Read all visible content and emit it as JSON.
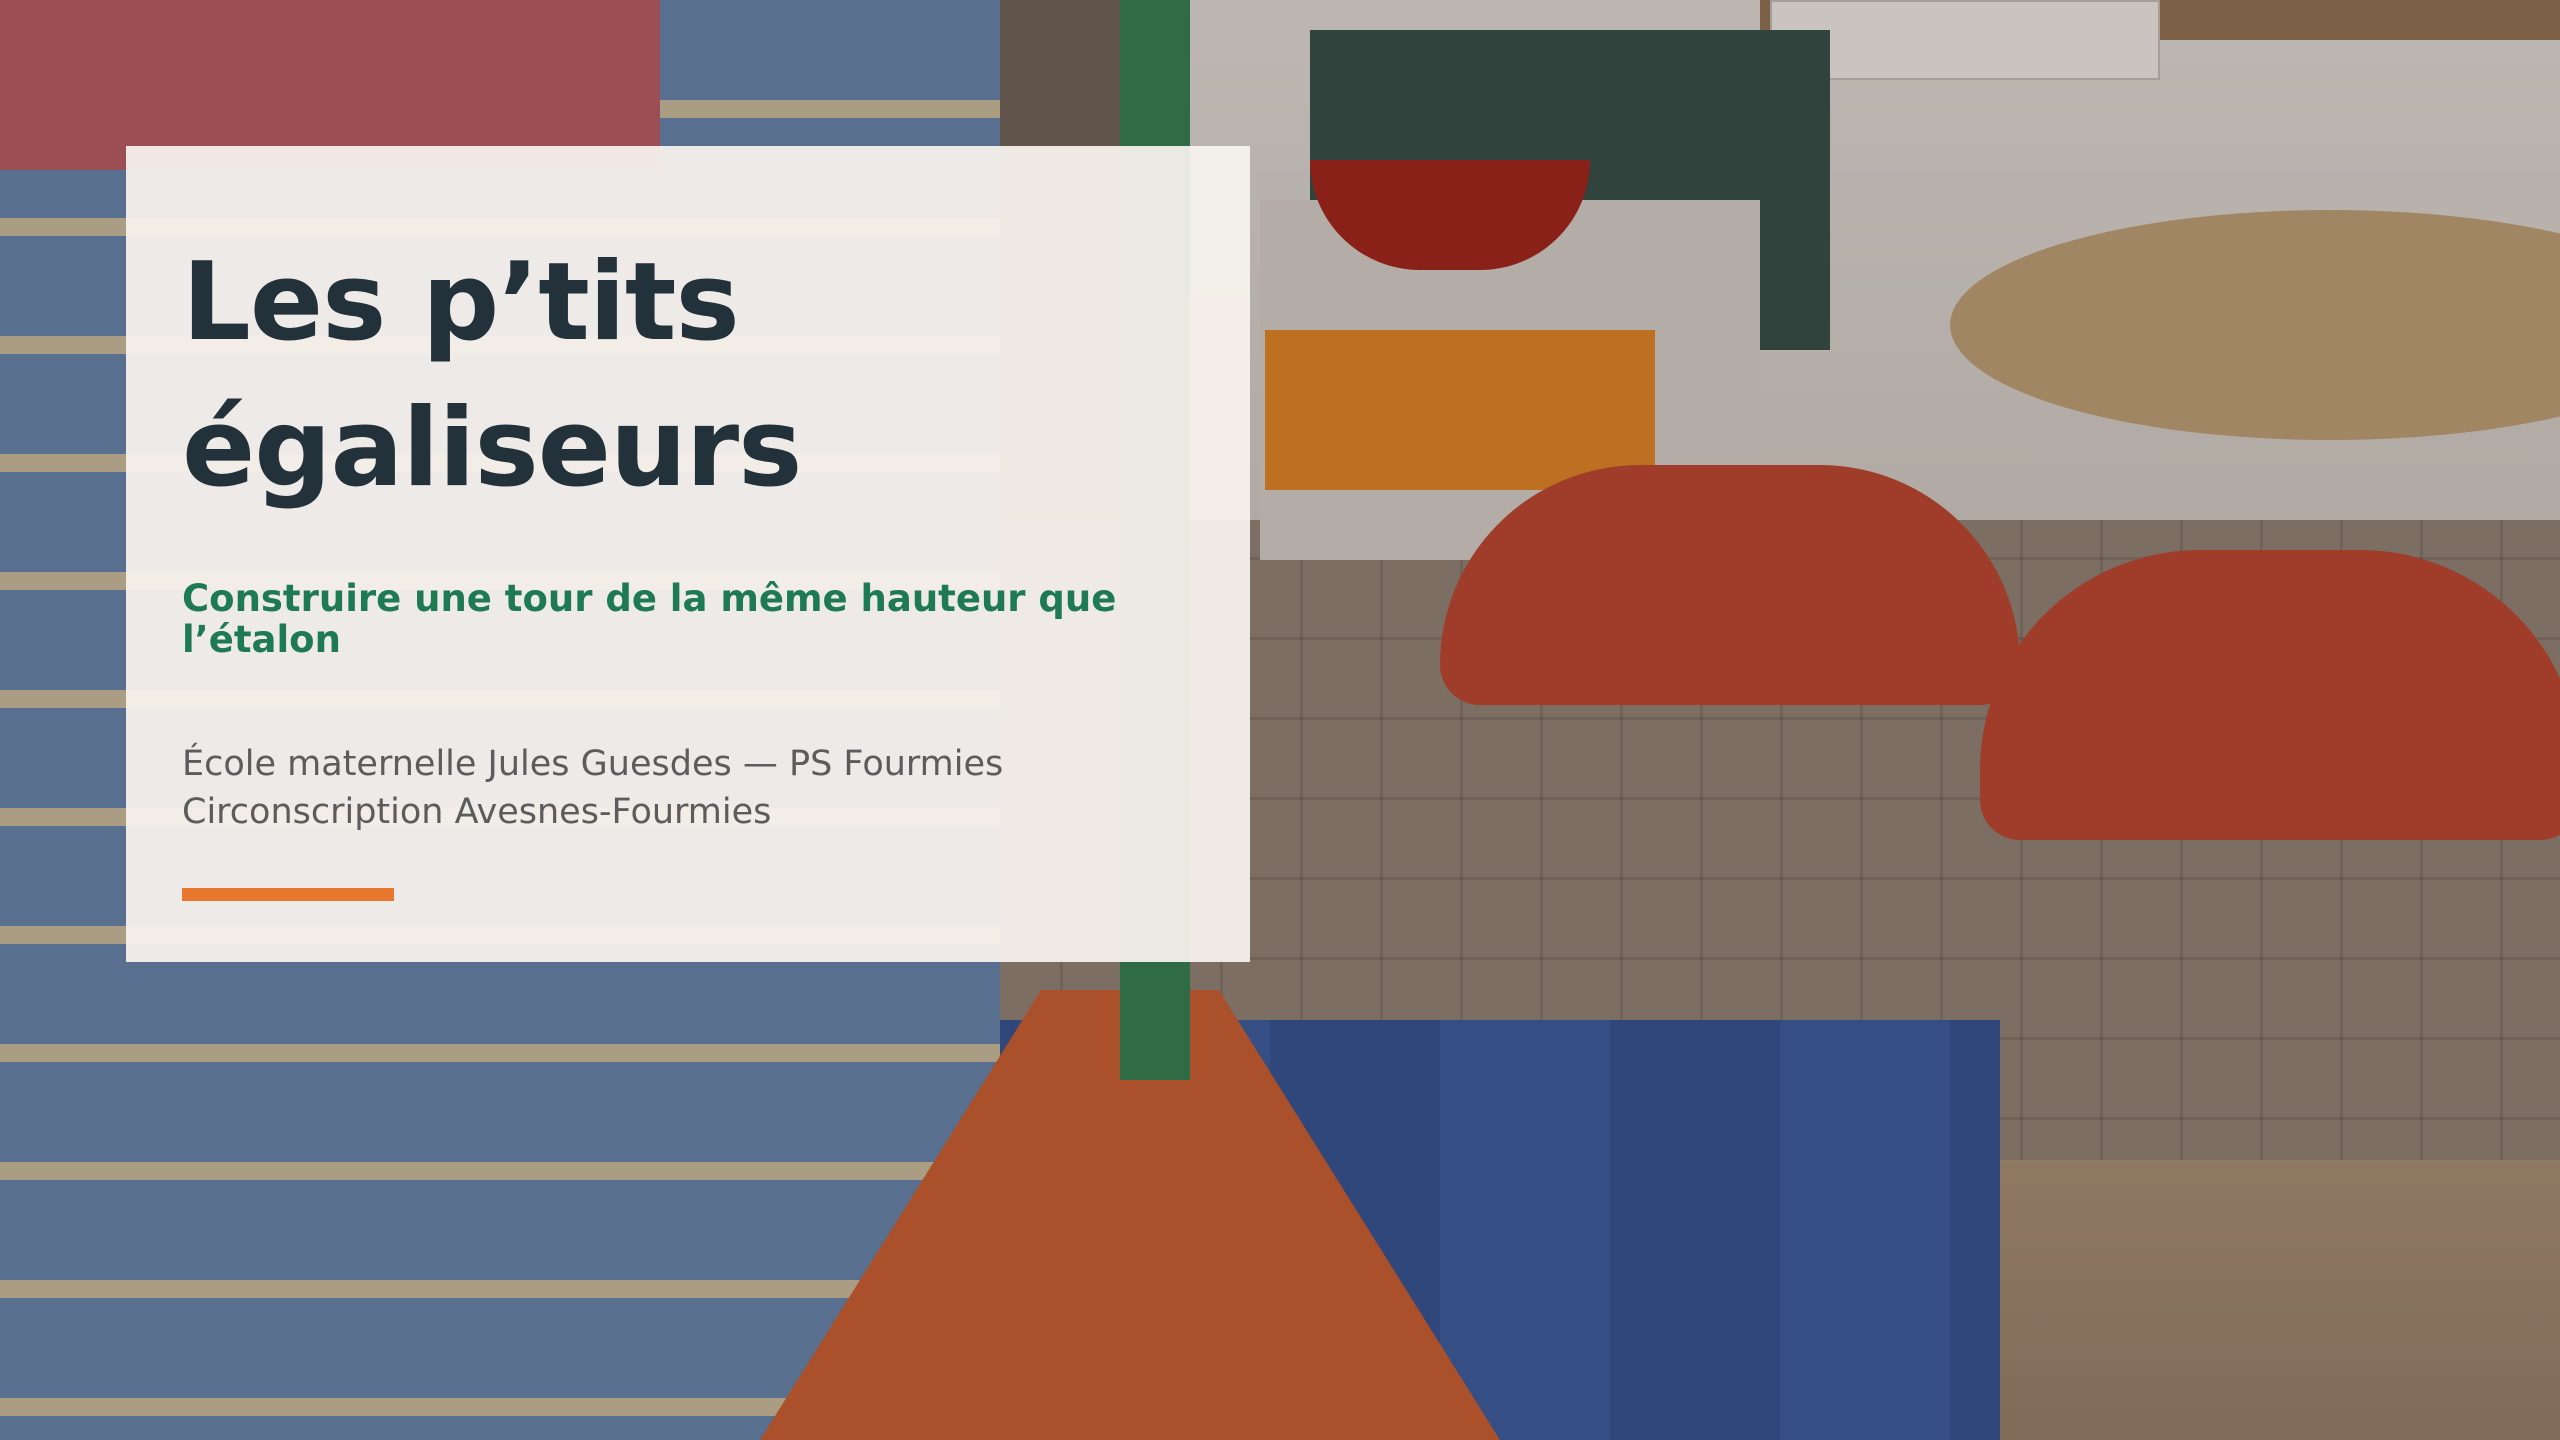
{
  "slide": {
    "title": "Les p’tits égaliseurs",
    "subtitle": "Construire une tour de la même hauteur que l’étalon",
    "school_line": "École maternelle Jules Guesdes — PS Fourmies",
    "district_line": "Circonscription Avesnes-Fourmies"
  },
  "colors": {
    "title": "#22313a",
    "subtitle": "#1e7a52",
    "meta": "#5c5c5c",
    "accent": "#e9782f",
    "card": "#f6f2ed"
  },
  "background": {
    "type": "classroom-photo"
  }
}
